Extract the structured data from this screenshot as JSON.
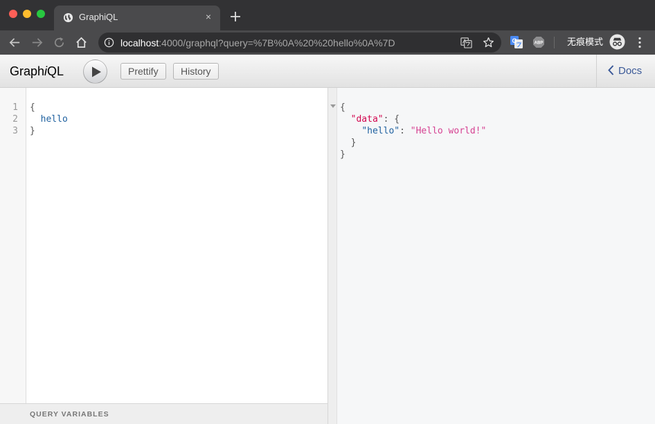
{
  "browser": {
    "tab_title": "GraphiQL",
    "tab_close": "×",
    "url_host": "localhost",
    "url_rest": ":4000/graphql?query=%7B%0A%20%20hello%0A%7D",
    "incognito_label": "无痕模式",
    "icons": [
      "back-icon",
      "forward-icon",
      "reload-icon",
      "home-icon",
      "info-icon",
      "translate-icon",
      "star-icon",
      "translate-extension-icon",
      "adblock-icon",
      "incognito-icon",
      "menu-icon",
      "new-tab-icon"
    ]
  },
  "graphiql": {
    "logo_pre": "Graph",
    "logo_i": "i",
    "logo_post": "QL",
    "prettify_label": "Prettify",
    "history_label": "History",
    "docs_label": "Docs",
    "query_variables_title": "QUERY VARIABLES",
    "query": {
      "line_numbers": [
        "1",
        "2",
        "3"
      ],
      "lines": [
        "{",
        "  hello",
        "}"
      ]
    },
    "result": {
      "open_brace": "{",
      "data_key": "\"data\"",
      "colon_brace": ": {",
      "hello_key": "\"hello\"",
      "colon": ": ",
      "hello_value": "\"Hello world!\"",
      "inner_close": "}",
      "close_brace": "}"
    }
  }
}
